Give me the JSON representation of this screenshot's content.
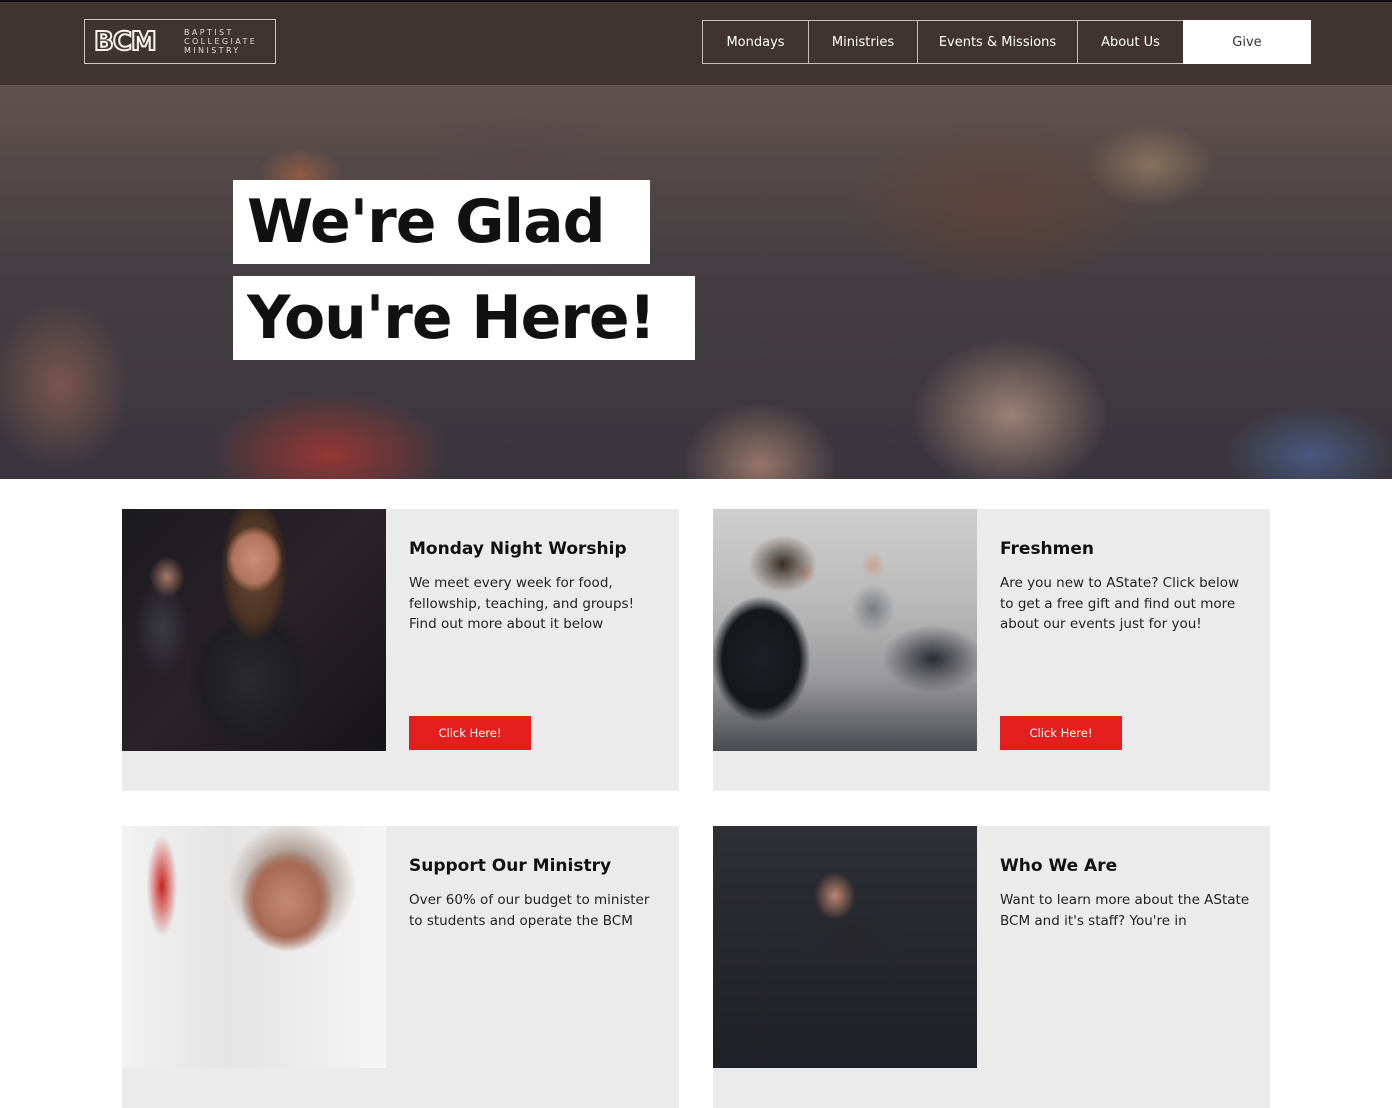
{
  "header": {
    "logo": {
      "mark": "BCM",
      "line1": "BAPTIST",
      "line2": "COLLEGIATE",
      "line3": "MINISTRY"
    },
    "nav": [
      {
        "label": "Mondays"
      },
      {
        "label": "Ministries"
      },
      {
        "label": "Events & Missions"
      },
      {
        "label": "About Us"
      },
      {
        "label": "Give"
      }
    ]
  },
  "hero": {
    "line1": "We're Glad",
    "line2": "You're Here!"
  },
  "cards": [
    {
      "title": "Monday Night Worship",
      "text": "We meet every week for food, fellowship, teaching, and groups! Find out more about it below",
      "button": "Click Here!"
    },
    {
      "title": "Freshmen",
      "text": "Are you new to AState? Click below to get a free gift and find out more about our events just for you!",
      "button": "Click Here!"
    },
    {
      "title": "Support Our Ministry",
      "text": "Over 60% of our budget to minister to students and operate the BCM"
    },
    {
      "title": "Who We Are",
      "text": "Want to learn more about the AState BCM and it's staff? You're in"
    }
  ],
  "colors": {
    "header_bg": "#3f342f",
    "accent_button": "#e41e1e",
    "card_bg": "#ebebeb"
  }
}
